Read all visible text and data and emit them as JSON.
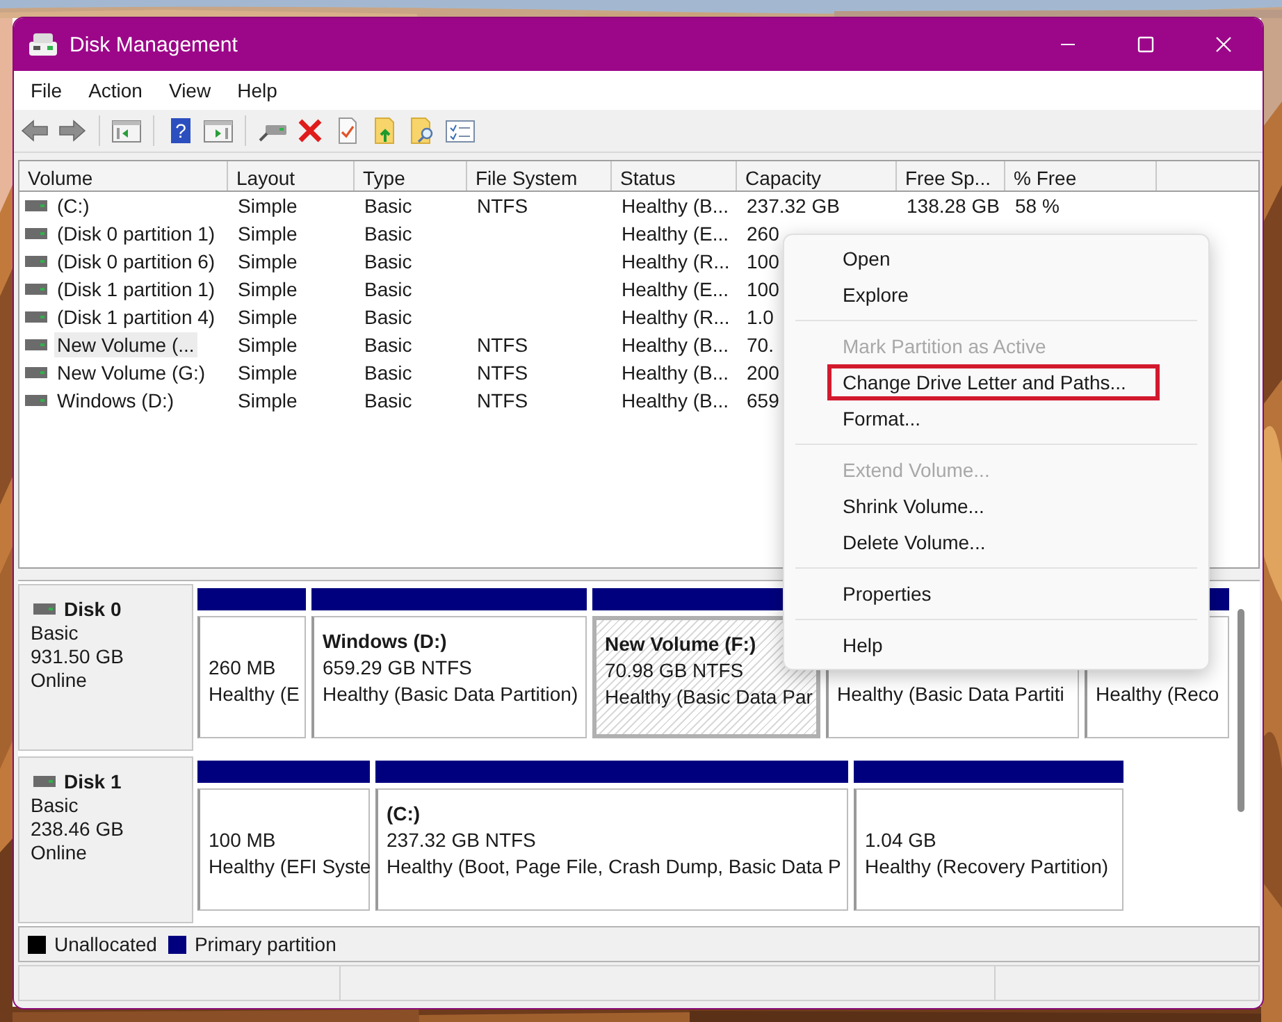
{
  "window": {
    "title": "Disk Management"
  },
  "menu_bar": [
    "File",
    "Action",
    "View",
    "Help"
  ],
  "toolbar": {
    "help_glyph": "?"
  },
  "volume_table": {
    "columns": [
      "Volume",
      "Layout",
      "Type",
      "File System",
      "Status",
      "Capacity",
      "Free Sp...",
      "% Free"
    ],
    "rows": [
      {
        "volume": "(C:)",
        "layout": "Simple",
        "type": "Basic",
        "file_system": "NTFS",
        "status": "Healthy (B...",
        "capacity": "237.32 GB",
        "free_space": "138.28 GB",
        "percent_free": "58 %",
        "selected": false
      },
      {
        "volume": "(Disk 0 partition 1)",
        "layout": "Simple",
        "type": "Basic",
        "status": "Healthy (E...",
        "capacity": "260",
        "selected": false
      },
      {
        "volume": "(Disk 0 partition 6)",
        "layout": "Simple",
        "type": "Basic",
        "status": "Healthy (R...",
        "capacity": "100",
        "selected": false
      },
      {
        "volume": "(Disk 1 partition 1)",
        "layout": "Simple",
        "type": "Basic",
        "status": "Healthy (E...",
        "capacity": "100",
        "selected": false
      },
      {
        "volume": "(Disk 1 partition 4)",
        "layout": "Simple",
        "type": "Basic",
        "status": "Healthy (R...",
        "capacity": "1.0",
        "selected": false
      },
      {
        "volume": "New Volume (...",
        "layout": "Simple",
        "type": "Basic",
        "file_system": "NTFS",
        "status": "Healthy (B...",
        "capacity": "70.",
        "selected": true
      },
      {
        "volume": "New Volume (G:)",
        "layout": "Simple",
        "type": "Basic",
        "file_system": "NTFS",
        "status": "Healthy (B...",
        "capacity": "200",
        "selected": false
      },
      {
        "volume": "Windows (D:)",
        "layout": "Simple",
        "type": "Basic",
        "file_system": "NTFS",
        "status": "Healthy (B...",
        "capacity": "659",
        "selected": false
      }
    ]
  },
  "disks": [
    {
      "name": "Disk 0",
      "type": "Basic",
      "size": "931.50 GB",
      "state": "Online",
      "partitions": [
        {
          "size": "260 MB",
          "status": "Healthy (E",
          "selected": false
        },
        {
          "name": "Windows  (D:)",
          "size": "659.29 GB NTFS",
          "status": "Healthy (Basic Data Partition)",
          "selected": false
        },
        {
          "name": "New Volume  (F:)",
          "size": "70.98 GB NTFS",
          "status": "Healthy (Basic Data Par",
          "selected": true
        },
        {
          "status": "Healthy (Basic Data Partiti",
          "selected": false
        },
        {
          "status": "Healthy (Reco",
          "selected": false
        }
      ]
    },
    {
      "name": "Disk 1",
      "type": "Basic",
      "size": "238.46 GB",
      "state": "Online",
      "partitions": [
        {
          "size": "100 MB",
          "status": "Healthy (EFI Syste",
          "selected": false
        },
        {
          "name": "(C:)",
          "size": "237.32 GB NTFS",
          "status": "Healthy (Boot, Page File, Crash Dump, Basic Data P",
          "selected": false
        },
        {
          "size": "1.04 GB",
          "status": "Healthy (Recovery Partition)",
          "selected": false
        }
      ]
    }
  ],
  "legend": [
    {
      "label": "Unallocated",
      "color": "#000000"
    },
    {
      "label": "Primary partition",
      "color": "#00007f"
    }
  ],
  "context_menu": [
    {
      "kind": "item",
      "label": "Open",
      "disabled": false,
      "outlined": false
    },
    {
      "kind": "item",
      "label": "Explore",
      "disabled": false,
      "outlined": false
    },
    {
      "kind": "separator"
    },
    {
      "kind": "item",
      "label": "Mark Partition as Active",
      "disabled": true,
      "outlined": false
    },
    {
      "kind": "item",
      "label": "Change Drive Letter and Paths...",
      "disabled": false,
      "outlined": true
    },
    {
      "kind": "item",
      "label": "Format...",
      "disabled": false,
      "outlined": false
    },
    {
      "kind": "separator"
    },
    {
      "kind": "item",
      "label": "Extend Volume...",
      "disabled": true,
      "outlined": false
    },
    {
      "kind": "item",
      "label": "Shrink Volume...",
      "disabled": false,
      "outlined": false
    },
    {
      "kind": "item",
      "label": "Delete Volume...",
      "disabled": false,
      "outlined": false
    },
    {
      "kind": "separator"
    },
    {
      "kind": "item",
      "label": "Properties",
      "disabled": false,
      "outlined": false
    },
    {
      "kind": "separator"
    },
    {
      "kind": "item",
      "label": "Help",
      "disabled": false,
      "outlined": false
    }
  ]
}
